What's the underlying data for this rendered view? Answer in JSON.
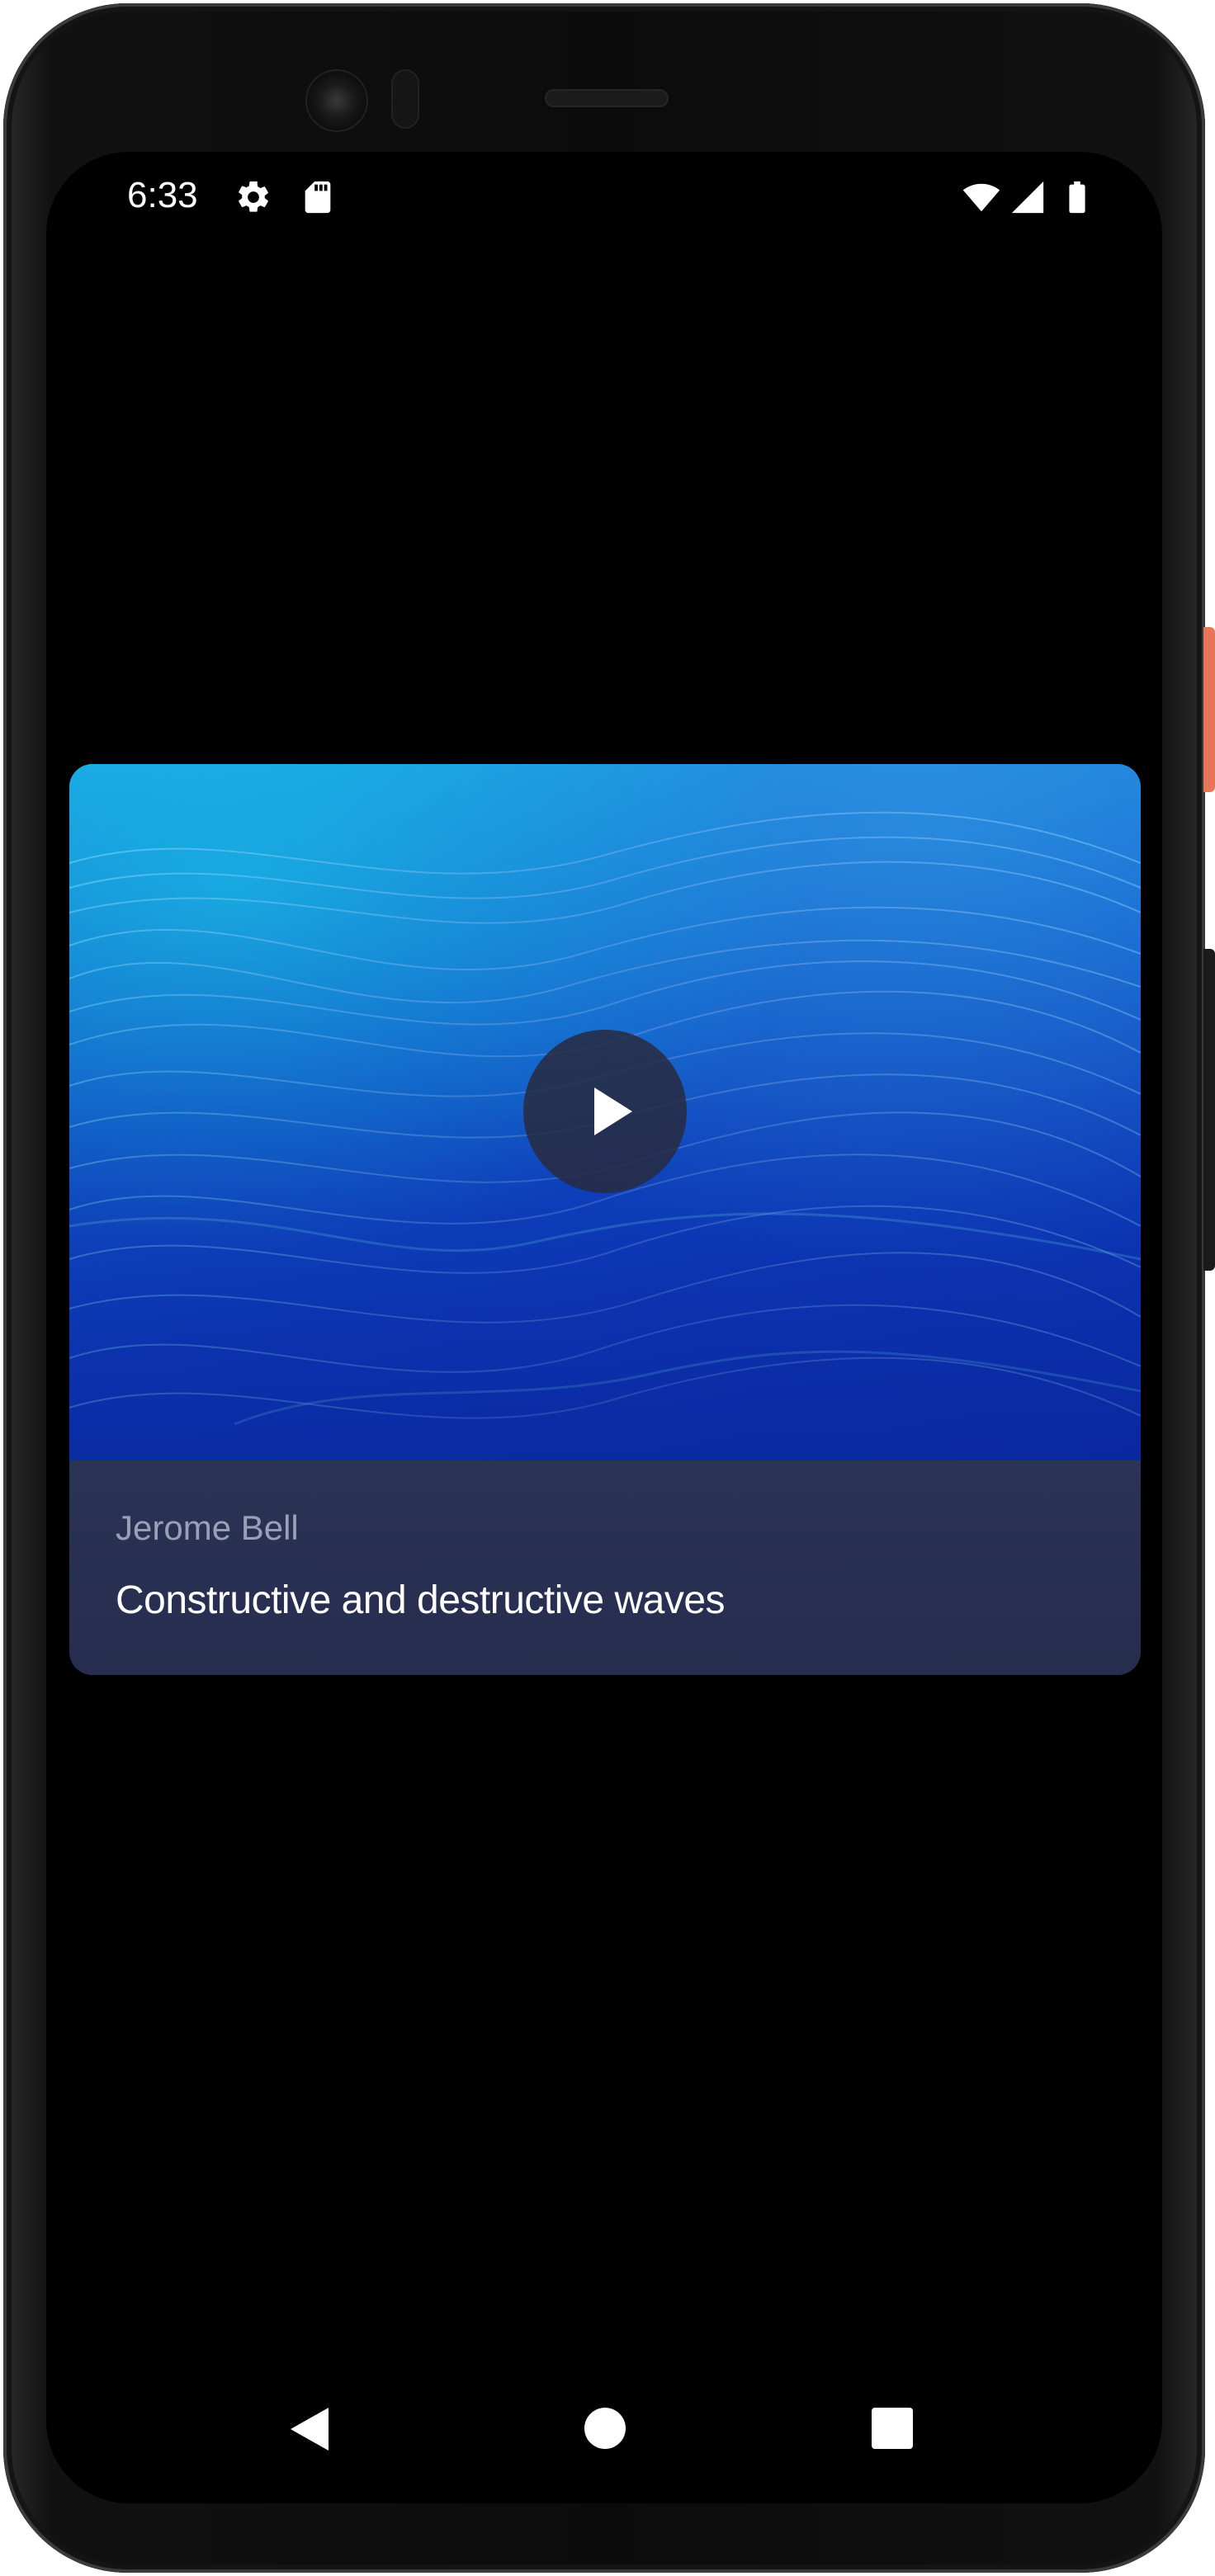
{
  "status_bar": {
    "time": "6:33",
    "left_icons": [
      "settings-gear-icon",
      "sd-card-icon"
    ],
    "right_icons": [
      "wifi-icon",
      "cellular-signal-icon",
      "battery-icon"
    ]
  },
  "video_card": {
    "author": "Jerome Bell",
    "title": "Constructive and destructive waves",
    "thumbnail": "blue-waves-thumbnail",
    "play_icon": "play-icon"
  },
  "nav_bar": {
    "buttons": [
      "back-icon",
      "home-icon",
      "recents-icon"
    ]
  },
  "colors": {
    "screen_background": "#000000",
    "card_info_background": "#283152",
    "author_text": "#9aa0b6",
    "title_text": "#ffffff",
    "side_button_accent": "#e8745a"
  }
}
